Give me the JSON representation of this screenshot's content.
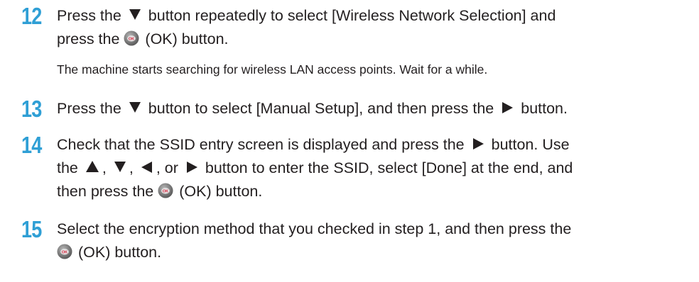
{
  "steps": [
    {
      "number": "12",
      "parts": {
        "p1": "Press the",
        "p2": "button repeatedly to select [Wireless Network Selection] and",
        "p3": "press the",
        "p4": "(OK) button."
      },
      "note": "The machine starts searching for wireless LAN access points. Wait for a while."
    },
    {
      "number": "13",
      "parts": {
        "p1": "Press the",
        "p2": "button to select [Manual Setup], and then press the",
        "p3": "button."
      }
    },
    {
      "number": "14",
      "parts": {
        "p1": "Check that the SSID entry screen is displayed and press the",
        "p2": "button. Use",
        "p3": "the",
        "p4": ",",
        "p5": ",",
        "p6": ", or",
        "p7": "button to enter the SSID, select [Done] at the end, and",
        "p8": "then press the",
        "p9": "(OK) button."
      }
    },
    {
      "number": "15",
      "parts": {
        "p1": "Select the encryption method that you checked in step 1, and then press the",
        "p2": "(OK) button."
      }
    }
  ],
  "icons": {
    "down": "down-arrow-button-icon",
    "up": "up-arrow-button-icon",
    "left": "left-arrow-button-icon",
    "right": "right-arrow-button-icon",
    "ok": "ok-button-icon"
  },
  "colors": {
    "step_number": "#2f9fd5",
    "text": "#231f20",
    "ok_icon_fill": "#d7263d"
  }
}
